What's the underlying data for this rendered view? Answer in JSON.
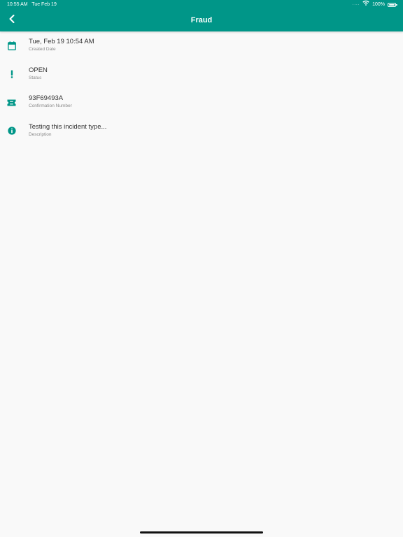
{
  "status_bar": {
    "time": "10:55 AM",
    "date": "Tue Feb 19",
    "signal": "····",
    "wifi_icon": "wifi-icon",
    "battery_text": "100%",
    "battery_level": 1.0
  },
  "nav": {
    "title": "Fraud",
    "back_icon": "chevron-left-icon"
  },
  "colors": {
    "primary": "#009688",
    "background": "#f9f9f9",
    "value_text": "#333333",
    "label_text": "#8a8a8a"
  },
  "details": [
    {
      "icon": "calendar-icon",
      "value": "Tue, Feb 19 10:54 AM",
      "label": "Created Date"
    },
    {
      "icon": "exclamation-icon",
      "value": "OPEN",
      "label": "Status"
    },
    {
      "icon": "ticket-icon",
      "value": "93F69493A",
      "label": "Confirmation Number"
    },
    {
      "icon": "info-icon",
      "value": "Testing this incident type...",
      "label": "Description"
    }
  ]
}
